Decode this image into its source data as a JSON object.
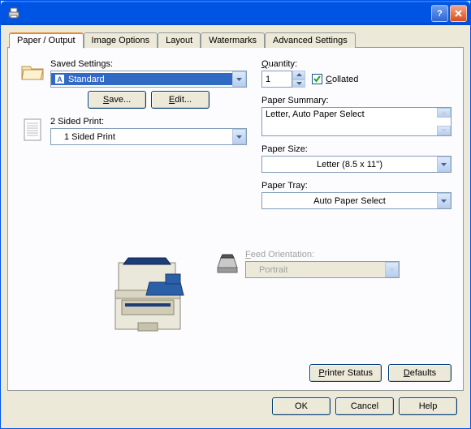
{
  "tabs": {
    "paper_output": "Paper / Output",
    "image_options": "Image Options",
    "layout": "Layout",
    "watermarks": "Watermarks",
    "advanced_settings": "Advanced Settings"
  },
  "saved_settings": {
    "label": "Saved Settings:",
    "value": "Standard",
    "save_btn": "Save...",
    "edit_btn": "Edit..."
  },
  "two_sided": {
    "label": "2 Sided Print:",
    "value": "1 Sided Print"
  },
  "quantity": {
    "label": "Quantity:",
    "value": "1",
    "collated_label": "Collated",
    "collated_checked": true
  },
  "paper_summary": {
    "label": "Paper Summary:",
    "value": "Letter, Auto Paper Select"
  },
  "paper_size": {
    "label": "Paper Size:",
    "value": "Letter (8.5 x 11'')"
  },
  "paper_tray": {
    "label": "Paper Tray:",
    "value": "Auto Paper Select"
  },
  "feed_orientation": {
    "label": "Feed Orientation:",
    "value": "Portrait"
  },
  "buttons": {
    "printer_status": "Printer Status",
    "defaults": "Defaults",
    "ok": "OK",
    "cancel": "Cancel",
    "help": "Help"
  },
  "mnemonics": {
    "save_s": "S",
    "save_rest": "ave...",
    "edit_e": "E",
    "edit_rest": "dit...",
    "quantity_q": "Q",
    "quantity_rest": "uantity:",
    "collated_c": "C",
    "collated_rest": "ollated",
    "feed_f": "F",
    "feed_rest": "eed Orientation:",
    "pstatus_p": "P",
    "pstatus_rest": "rinter Status",
    "defaults_d": "D",
    "defaults_rest": "efaults"
  }
}
